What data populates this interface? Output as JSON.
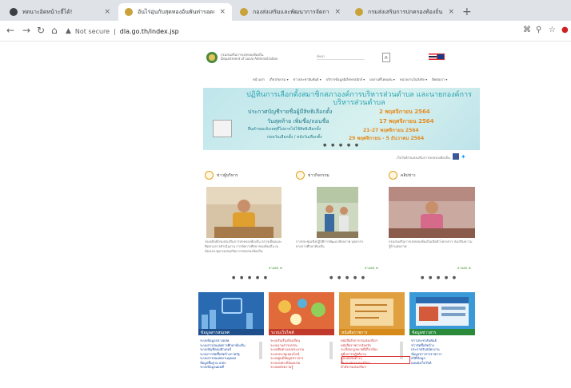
{
  "browser": {
    "tabs": [
      {
        "title": "ทดนาะอิดหน้าะยี่ได้!",
        "close": "×",
        "fav": "#3c4043"
      },
      {
        "title": "อันไร่อุ่นกับสุดทองอ้นพันท่ารอดแห่",
        "close": "×",
        "fav": "#caa23a"
      },
      {
        "title": "กองส่งเสริมและพัฒนาการจัดการศึ",
        "close": "×",
        "fav": "#caa23a"
      },
      {
        "title": "กรมส่งเสริมการปกครองท้องถิ่น",
        "close": "×",
        "fav": "#caa23a"
      }
    ],
    "new_tab": "+",
    "address": {
      "security": "Not secure",
      "url": "dla.go.th/index.jsp"
    }
  },
  "site": {
    "title": "กรมส่งเสริมการปกครองท้องถิ่น",
    "subtitle": "Department of Local Administration",
    "search_placeholder": "ค้นหา",
    "font_control": "ก",
    "menu": [
      "หน้าแรก",
      "เกี่ยวกับกรม ▾",
      "ข่าวประชาสัมพันธ์ ▾",
      "บริการข้อมูลอิเล็กทรอนิกส์ ▾",
      "ผลงานที่โดดเด่น ▾",
      "หน่วยงานในสังกัด ▾",
      "ติดต่อเรา ▾"
    ],
    "banner": {
      "title": "ปฏิทินการเลือกตั้งสมาชิกสภาองค์การบริหารส่วนตำบล และนายกองค์การบริหารส่วนตำบล",
      "rows": [
        {
          "label": "ประกาศบัญชีรายชื่อผู้มีสิทธิเลือกตั้ง",
          "date": "2 พฤศจิกายน 2564"
        },
        {
          "label": "วันสุดท้าย เพิ่มชื่อ/ถอนชื่อ",
          "date": "17 พฤศจิกายน 2564"
        },
        {
          "label": "ยื่นคำขอแจ้งเหตุที่ไม่อาจไปใช้สิทธิเลือกตั้ง",
          "date": "21-27 พฤศจิกายน 2564"
        },
        {
          "label": "ก่อนวันเลือกตั้ง / หลังวันเลือกตั้ง",
          "date": "29 พฤศจิกายน - 5 ธันวาคม 2564"
        }
      ],
      "pager": "● ● ● ● ●"
    },
    "share_label": "เว็บไซต์กรมส่งเสริมการปกครองท้องถิ่น",
    "columns": [
      {
        "head": "ข่าวผู้บริหาร",
        "caption": "รองอธิบดีกรมส่งเสริมการปกครองท้องถิ่น ตรวจเยี่ยมและติดตามการดำเนินงาน การจัดการศึกษาของท้องถิ่น ณ ห้องประชุมกรมส่งเสริมการปกครองท้องถิ่น",
        "more": "อ่านต่อ ⊕",
        "pager": "● ● ● ● ●"
      },
      {
        "head": "ข่าวกิจกรรม",
        "caption": "การประชุมเชิงปฏิบัติการพัฒนาศักยภาพ บุคลากรทางการศึกษาท้องถิ่น",
        "more": "อ่านต่อ ⊕",
        "pager": "● ● ● ● ●"
      },
      {
        "head": "คลิปข่าว",
        "caption": "กรมส่งเสริมการปกครองท้องถิ่นเปิดตัวโครงการ ส่งเสริมความรู้ด้านสุขภาพ",
        "more": "อ่านต่อ ⊕",
        "pager": "● ● ● ● ●"
      }
    ],
    "cards": [
      {
        "label": "ข้อมูลสารสนเทศ",
        "items": [
          "ระบบข้อมูลกลางอปท.",
          "ระบบสารสนเทศการศึกษาท้องถิ่น",
          "ระบบบัญชีคอมพิวเตอร์",
          "ระบบการจัดซื้อจัดจ้างภาครัฐ",
          "ระบบสารสนเทศงานบุคคล",
          "ข้อมูลพื้นฐาน อปท.",
          "ระบบข้อมูลแผนที่"
        ]
      },
      {
        "label": "ระบบเว็บไซต์",
        "items": [
          "ระบบรับเรื่องร้องเรียน",
          "ระบบงานสารบรรณ",
          "ระบบติดตามงบประมาณ",
          "ระบบประชุมออนไลน์",
          "ระบบศูนย์ข้อมูลข่าวสาร",
          "ระบบลงทะเบียนอบรม",
          "ระบบคลังความรู้"
        ]
      },
      {
        "label": "หนังสือราชการ",
        "items": [
          "หนังสือสั่งการกรมส่งเสริมฯ",
          "หนังสือราชการจังหวัด",
          "ระเบียบกฎหมายที่เกี่ยวข้อง",
          "คู่มือการปฏิบัติงาน",
          "แบบฟอร์มต่างๆ",
          "ประกาศกรมส่งเสริมฯ",
          "คำสั่งกรมส่งเสริมฯ"
        ]
      },
      {
        "label": "ข้อมูลข่าวสาร",
        "items": [
          "ข่าวประชาสัมพันธ์",
          "ข่าวจัดซื้อจัดจ้าง",
          "ประกาศรับสมัครงาน",
          "ข้อมูลข่าวสารราชการ",
          "สถิติข้อมูล",
          "แผนผังเว็บไซต์"
        ]
      }
    ]
  }
}
